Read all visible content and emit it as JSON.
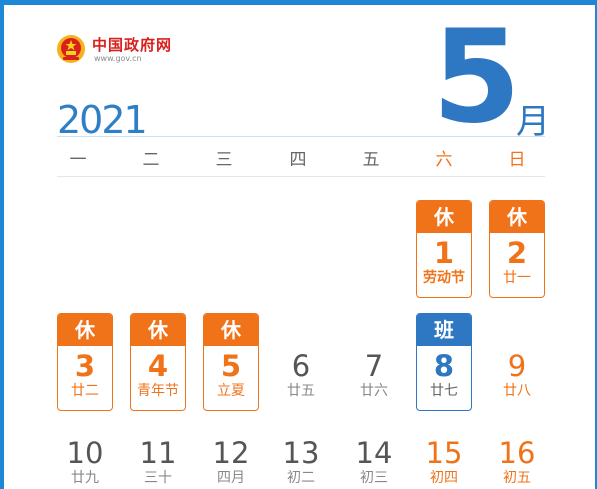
{
  "logo": {
    "name": "中国政府网",
    "url": "www.gov.cn"
  },
  "header": {
    "year": "2021",
    "month_number": "5",
    "month_char": "月"
  },
  "weekdays": [
    "一",
    "二",
    "三",
    "四",
    "五",
    "六",
    "日"
  ],
  "days": [
    {
      "day": "1",
      "lunar": "劳动节",
      "tag": "休"
    },
    {
      "day": "2",
      "lunar": "廿一",
      "tag": "休"
    },
    {
      "day": "3",
      "lunar": "廿二",
      "tag": "休"
    },
    {
      "day": "4",
      "lunar": "青年节",
      "tag": "休"
    },
    {
      "day": "5",
      "lunar": "立夏",
      "tag": "休"
    },
    {
      "day": "6",
      "lunar": "廿五"
    },
    {
      "day": "7",
      "lunar": "廿六"
    },
    {
      "day": "8",
      "lunar": "廿七",
      "tag": "班"
    },
    {
      "day": "9",
      "lunar": "廿八"
    },
    {
      "day": "10",
      "lunar": "廿九"
    },
    {
      "day": "11",
      "lunar": "三十"
    },
    {
      "day": "12",
      "lunar": "四月"
    },
    {
      "day": "13",
      "lunar": "初二"
    },
    {
      "day": "14",
      "lunar": "初三"
    },
    {
      "day": "15",
      "lunar": "初四"
    },
    {
      "day": "16",
      "lunar": "初五"
    }
  ],
  "colors": {
    "blue": "#2e77c2",
    "orange": "#f0731a",
    "red": "#d9201c"
  }
}
